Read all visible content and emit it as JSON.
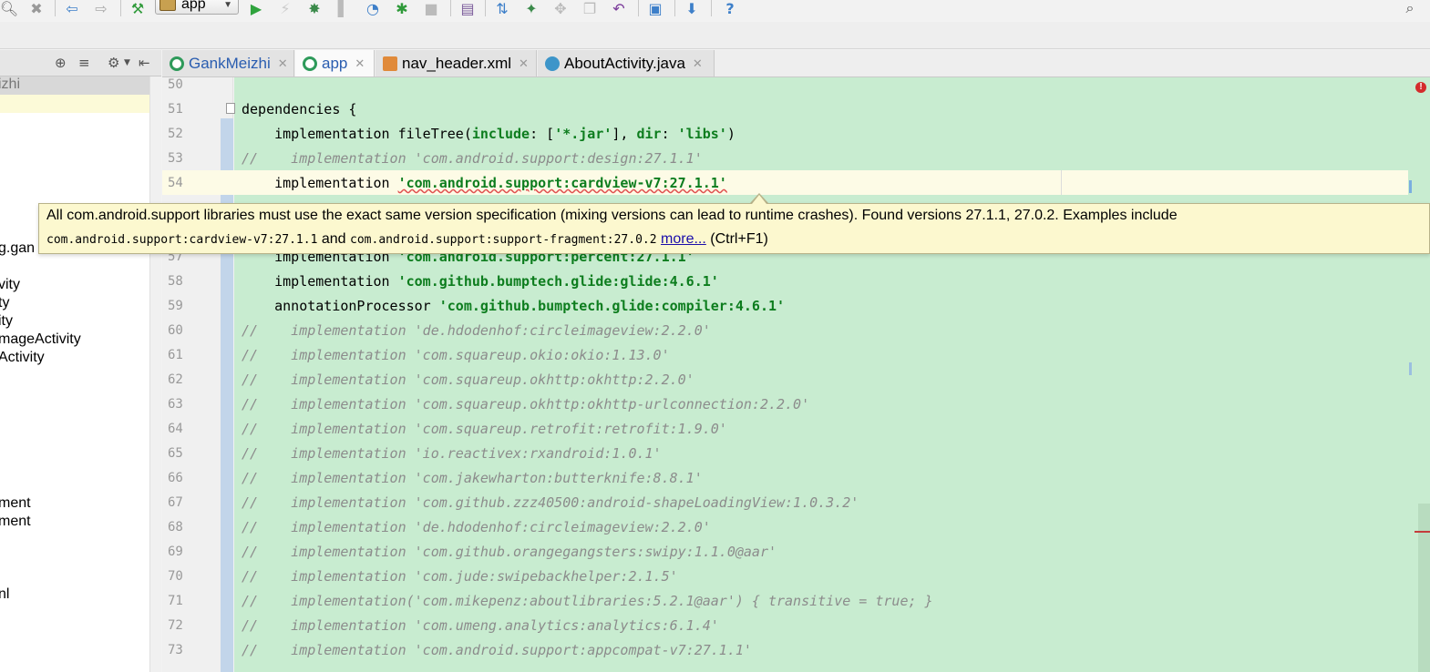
{
  "toolbar": {
    "run_config": "app",
    "icons": [
      "search-icon",
      "replace-icon",
      "back-icon",
      "forward-icon",
      "build-icon",
      "run-icon",
      "apply-changes-icon",
      "debug-icon",
      "coverage-icon",
      "profile-icon",
      "attach-debugger-icon",
      "stop-icon",
      "avd-manager-icon",
      "sync-icon",
      "gradle-icon",
      "structure-icon",
      "undo-icon",
      "layout-inspector-icon",
      "sdk-manager-icon",
      "help-icon",
      "search-everywhere-icon"
    ]
  },
  "project_panel": {
    "items": [
      {
        "label": "izhi",
        "dim": true
      },
      {
        "label": "g.gan"
      },
      {
        "label": "vity"
      },
      {
        "label": "ty"
      },
      {
        "label": "ity"
      },
      {
        "label": "mageActivity"
      },
      {
        "label": "Activity"
      },
      {
        "label": "ment"
      },
      {
        "label": "ment"
      },
      {
        "label": "nl"
      }
    ]
  },
  "tabs": [
    {
      "label": "GankMeizhi",
      "icon": "gradle-module-icon"
    },
    {
      "label": "app",
      "icon": "gradle-module-icon"
    },
    {
      "label": "nav_header.xml",
      "icon": "xml-file-icon"
    },
    {
      "label": "AboutActivity.java",
      "icon": "java-class-icon"
    }
  ],
  "editor": {
    "line_numbers": [
      "50",
      "51",
      "52",
      "53",
      "54",
      "57",
      "58",
      "59",
      "60",
      "61",
      "62",
      "63",
      "64",
      "65",
      "66",
      "67",
      "68",
      "69",
      "70",
      "71",
      "72",
      "73"
    ],
    "lines": {
      "l51": "dependencies {",
      "l52_a": "    implementation fileTree(",
      "l52_b": "include",
      "l52_c": ": [",
      "l52_d": "'*.jar'",
      "l52_e": "], ",
      "l52_f": "dir",
      "l52_g": ": ",
      "l52_h": "'libs'",
      "l52_i": ")",
      "l53": "//    implementation 'com.android.support:design:27.1.1'",
      "l54_a": "    implementation ",
      "l54_b": "'com.android.support:cardview-v7:27.1.1'",
      "l57_a": "    implementation ",
      "l57_b": "'com.android.support:percent:27.1.1'",
      "l58_a": "    implementation ",
      "l58_b": "'com.github.bumptech.glide:glide:4.6.1'",
      "l59_a": "    annotationProcessor ",
      "l59_b": "'com.github.bumptech.glide:compiler:4.6.1'",
      "l60": "//    implementation 'de.hdodenhof:circleimageview:2.2.0'",
      "l61": "//    implementation 'com.squareup.okio:okio:1.13.0'",
      "l62": "//    implementation 'com.squareup.okhttp:okhttp:2.2.0'",
      "l63": "//    implementation 'com.squareup.okhttp:okhttp-urlconnection:2.2.0'",
      "l64": "//    implementation 'com.squareup.retrofit:retrofit:1.9.0'",
      "l65": "//    implementation 'io.reactivex:rxandroid:1.0.1'",
      "l66": "//    implementation 'com.jakewharton:butterknife:8.8.1'",
      "l67": "//    implementation 'com.github.zzz40500:android-shapeLoadingView:1.0.3.2'",
      "l68": "//    implementation 'de.hdodenhof:circleimageview:2.2.0'",
      "l69": "//    implementation 'com.github.orangegangsters:swipy:1.1.0@aar'",
      "l70": "//    implementation 'com.jude:swipebackhelper:2.1.5'",
      "l71": "//    implementation('com.mikepenz:aboutlibraries:5.2.1@aar') { transitive = true; }",
      "l72": "//    implementation 'com.umeng.analytics:analytics:6.1.4'",
      "l73": "//    implementation 'com.android.support:appcompat-v7:27.1.1'"
    }
  },
  "tooltip": {
    "message": "All com.android.support libraries must use the exact same version specification (mixing versions can lead to runtime crashes). Found versions 27.1.1, 27.0.2. Examples include",
    "lib1": "com.android.support:cardview-v7:27.1.1",
    "and": " and ",
    "lib2": "com.android.support:support-fragment:27.0.2",
    "more": "more...",
    "shortcut": " (Ctrl+F1)"
  },
  "colors": {
    "editor_bg": "#c8ecd0",
    "string": "#0d7d1e",
    "comment": "#8c8c8c",
    "tooltip_bg": "#fcf8cf",
    "error": "#d42c2c"
  }
}
